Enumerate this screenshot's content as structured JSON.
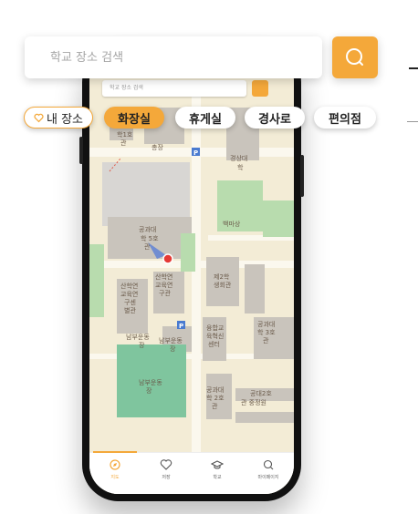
{
  "search": {
    "placeholder": "학교 장소 검색"
  },
  "screen_search": {
    "placeholder": "학교 장소 검색"
  },
  "chips": [
    {
      "label": "내 장소"
    },
    {
      "label": "화장실"
    },
    {
      "label": "휴게실"
    },
    {
      "label": "경사로"
    },
    {
      "label": "편의점"
    }
  ],
  "map_labels": {
    "l1": "학1호",
    "l2": "관",
    "l3": "총장",
    "l4": "경상대",
    "l5": "학",
    "l6": "공과대",
    "l7": "학 5호",
    "l8": "관",
    "l9": "백마상",
    "l10": "산학연",
    "l11": "교육연",
    "l12": "구센",
    "l13": "별관",
    "l14": "산학연",
    "l15": "교육연",
    "l16": "구관",
    "l17": "제2학",
    "l18": "생회관",
    "l19": "남부운동",
    "l20": "장",
    "l21": "남부운동",
    "l22": "장",
    "l23": "남부운동",
    "l24": "장",
    "l25": "융합교",
    "l26": "육혁신",
    "l27": "센터",
    "l28": "공과대",
    "l29": "학 3호",
    "l30": "관",
    "l31": "공과대",
    "l32": "학 2호",
    "l33": "관",
    "l34": "공대2호",
    "l35": "관 중정원"
  },
  "bottom_nav": [
    {
      "label": "지도",
      "icon": "map-icon"
    },
    {
      "label": "저장",
      "icon": "heart-icon"
    },
    {
      "label": "학교",
      "icon": "school-cap-icon"
    },
    {
      "label": "마이페이지",
      "icon": "search-icon"
    }
  ],
  "colors": {
    "accent": "#f4a83a",
    "map_bg": "#f3ecd6",
    "building": "#c9c4bc",
    "green": "#b8dcae"
  }
}
